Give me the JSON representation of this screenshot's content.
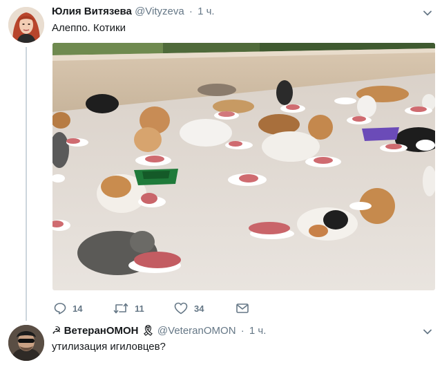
{
  "tweet1": {
    "name": "Юлия Витязева",
    "handle": "@Vityzeva",
    "separator": "·",
    "time": "1 ч.",
    "text": "Алеппо. Котики",
    "actions": {
      "replies": "14",
      "retweets": "11",
      "likes": "34"
    }
  },
  "tweet2": {
    "name_prefix": "☭",
    "name": "ВетеранОМОН",
    "name_suffix": "🎗",
    "handle": "@VeteranOMON",
    "separator": "·",
    "time": "1 ч.",
    "text": "утилизация игиловцев?"
  },
  "icons": {
    "reply": "reply-icon",
    "retweet": "retweet-icon",
    "like": "heart-icon",
    "message": "envelope-icon",
    "more": "chevron-down-icon"
  },
  "colors": {
    "text": "#14171a",
    "secondary": "#657786",
    "thread_line": "#ccd6dd"
  }
}
